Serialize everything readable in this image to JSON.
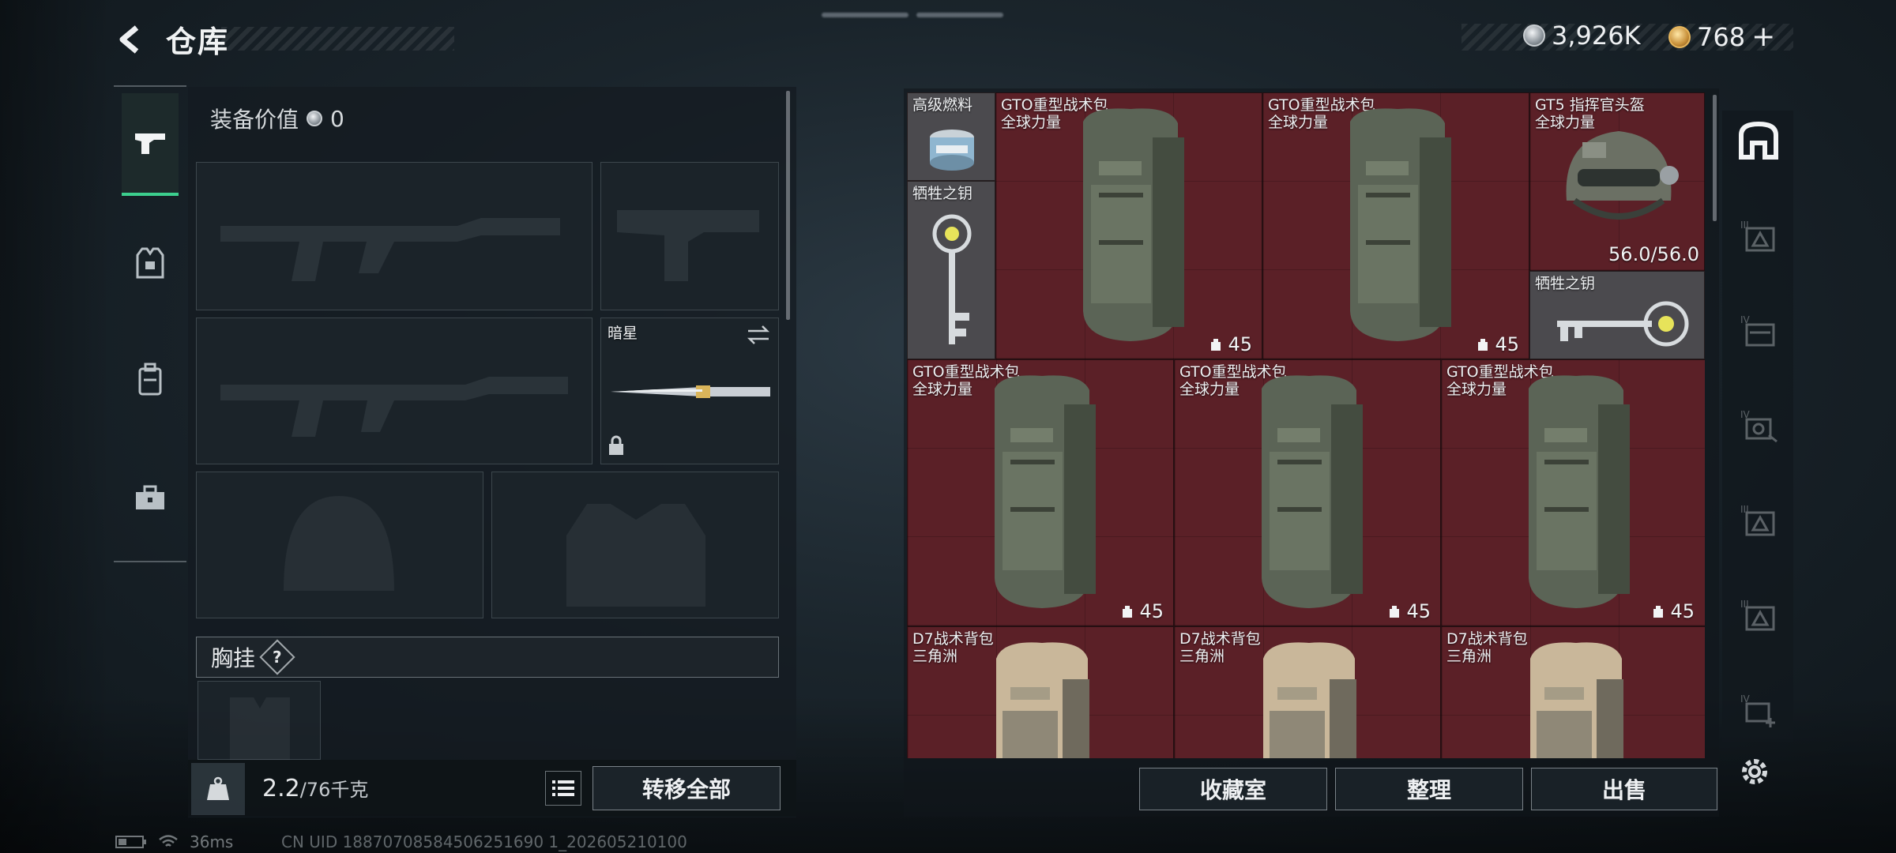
{
  "header": {
    "title": "仓库",
    "silver_amount": "3,926K",
    "gold_amount": "768",
    "gold_plus": "+"
  },
  "sidebar": {
    "tabs": [
      {
        "icon": "pistol-icon",
        "active": true
      },
      {
        "icon": "armor-vest-icon",
        "active": false
      },
      {
        "icon": "backpack-icon",
        "active": false
      },
      {
        "icon": "toolbox-icon",
        "active": false
      }
    ]
  },
  "loadout": {
    "equip_value_label": "装备价值",
    "equip_value": "0",
    "melee_name": "暗星",
    "chest_label": "胸挂",
    "chest_help": "?",
    "weight_current": "2.2",
    "weight_max": "/76千克",
    "transfer_all": "转移全部"
  },
  "stash": {
    "items": [
      {
        "name": "高级燃料",
        "sub": ""
      },
      {
        "name": "GTO重型战术包",
        "sub": "全球力量",
        "qty": "45"
      },
      {
        "name": "GTO重型战术包",
        "sub": "全球力量",
        "qty": "45"
      },
      {
        "name": "GT5 指挥官头盔",
        "sub": "全球力量",
        "durability": "56.0/56.0"
      },
      {
        "name": "牺牲之钥",
        "sub": ""
      },
      {
        "name": "牺牲之钥",
        "sub": ""
      },
      {
        "name": "GTO重型战术包",
        "sub": "全球力量",
        "qty": "45"
      },
      {
        "name": "GTO重型战术包",
        "sub": "全球力量",
        "qty": "45"
      },
      {
        "name": "GTO重型战术包",
        "sub": "全球力量",
        "qty": "45"
      },
      {
        "name": "D7战术背包",
        "sub": "三角洲"
      },
      {
        "name": "D7战术背包",
        "sub": "三角洲"
      },
      {
        "name": "D7战术背包",
        "sub": "三角洲"
      }
    ],
    "filters": [
      {
        "icon": "all-items-icon",
        "active": true
      },
      {
        "icon": "helmet-level-iii-icon",
        "tier": "III"
      },
      {
        "icon": "folder-level-iv-icon",
        "tier": "IV"
      },
      {
        "icon": "gear-level-iv-icon",
        "tier": "IV"
      },
      {
        "icon": "armor-level-iii-icon",
        "tier": "III"
      },
      {
        "icon": "armor-level-iii-icon",
        "tier": "III"
      },
      {
        "icon": "add-level-iv-icon",
        "tier": "IV"
      }
    ],
    "buttons": {
      "collection": "收藏室",
      "organize": "整理",
      "sell": "出售"
    }
  },
  "status": {
    "ping": "36ms",
    "uid": "CN UID 18870708584506251690 1_202605210100"
  },
  "colors": {
    "accent": "#3ccf8e",
    "grid_red": "#5b2027"
  }
}
